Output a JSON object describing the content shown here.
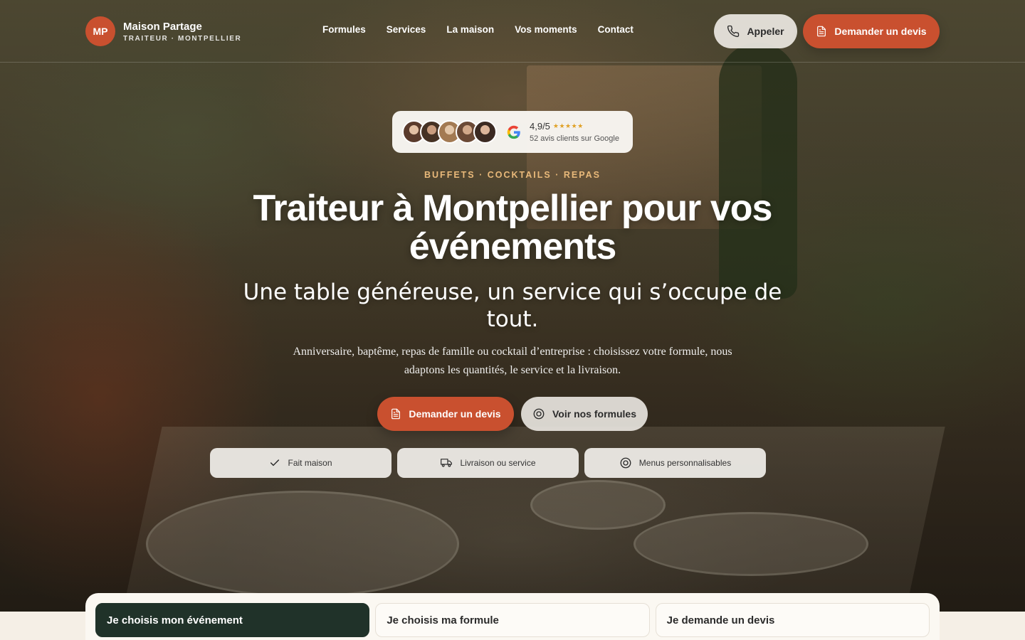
{
  "brand": {
    "initials": "MP",
    "name": "Maison Partage",
    "tagline": "TRAITEUR · MONTPELLIER",
    "accent_color": "#c9502f",
    "dark_color": "#203229"
  },
  "nav": {
    "items": [
      {
        "label": "Formules"
      },
      {
        "label": "Services"
      },
      {
        "label": "La maison"
      },
      {
        "label": "Vos moments"
      },
      {
        "label": "Contact"
      }
    ]
  },
  "header_actions": {
    "call_label": "Appeler",
    "call_icon": "phone-icon",
    "quote_label": "Demander un devis",
    "quote_icon": "document-icon"
  },
  "rating": {
    "score": "4,9/5",
    "stars": "★★★★★",
    "reviews_text": "52 avis clients sur Google",
    "provider_icon": "google-icon",
    "avatar_colors": [
      "#b9866a",
      "#8d6a55",
      "#c9a27d",
      "#a67a5c",
      "#7c5a48"
    ]
  },
  "hero": {
    "eyebrow": "BUFFETS · COCKTAILS · REPAS",
    "title": "Traiteur à Montpellier pour vos événements",
    "subtitle": "Une table généreuse, un service qui s’occupe de tout.",
    "lead": "Anniversaire, baptême, repas de famille ou cocktail d’entreprise : choisissez votre formule, nous adaptons les quantités, le service et la livraison.",
    "primary_cta": "Demander un devis",
    "primary_icon": "document-icon",
    "secondary_cta": "Voir nos formules",
    "secondary_icon": "target-icon"
  },
  "features": [
    {
      "label": "Fait maison",
      "icon": "check-icon"
    },
    {
      "label": "Livraison ou service",
      "icon": "truck-icon"
    },
    {
      "label": "Menus personnalisables",
      "icon": "target-icon"
    }
  ],
  "steps": [
    {
      "label": "Je choisis mon événement",
      "active": true
    },
    {
      "label": "Je choisis ma formule",
      "active": false
    },
    {
      "label": "Je demande un devis",
      "active": false
    }
  ]
}
